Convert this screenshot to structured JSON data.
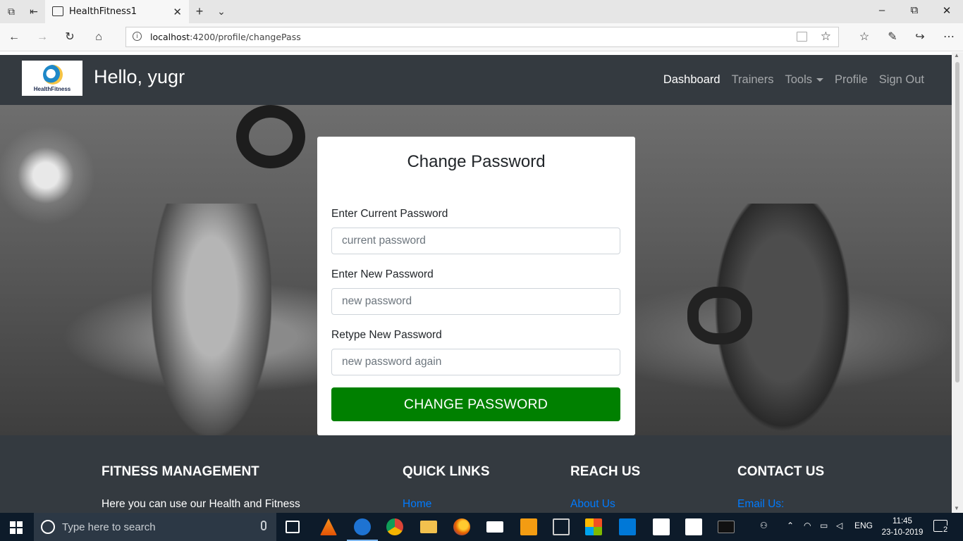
{
  "browser": {
    "tab_title": "HealthFitness1",
    "url_host": "localhost",
    "url_path": ":4200/profile/changePass"
  },
  "header": {
    "logo_text_1": "Health",
    "logo_text_2": "Fitness",
    "greeting": "Hello, yugr",
    "nav": {
      "dashboard": "Dashboard",
      "trainers": "Trainers",
      "tools": "Tools",
      "profile": "Profile",
      "sign_out": "Sign Out"
    }
  },
  "form": {
    "title": "Change Password",
    "current_label": "Enter Current Password",
    "current_placeholder": "current password",
    "new_label": "Enter New Password",
    "new_placeholder": "new password",
    "retype_label": "Retype New Password",
    "retype_placeholder": "new password again",
    "submit_label": "CHANGE PASSWORD"
  },
  "footer": {
    "col1_heading": "FITNESS MANAGEMENT",
    "col1_text": "Here you can use our Health and Fitness",
    "col2_heading": "QUICK LINKS",
    "col2_link": "Home",
    "col3_heading": "REACH US",
    "col3_link": "About Us",
    "col4_heading": "CONTACT US",
    "col4_link": "Email Us:"
  },
  "taskbar": {
    "search_placeholder": "Type here to search",
    "language": "ENG",
    "time": "11:45",
    "date": "23-10-2019",
    "notification_count": "2"
  },
  "colors": {
    "header_bg": "#343a40",
    "submit_bg": "#008000",
    "link": "#007bff"
  }
}
